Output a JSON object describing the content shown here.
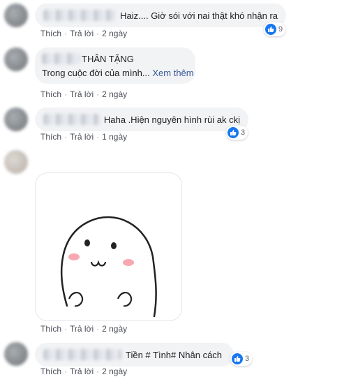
{
  "comments": [
    {
      "text": "Haiz.... Giờ sói với nai thật khó nhận ra",
      "reactions": "9",
      "actions": {
        "like": "Thích",
        "reply": "Trả lời",
        "time": "2 ngày"
      }
    },
    {
      "name_suffix": "THÂN TẶNG",
      "text": "Trong cuộc đời của mình...",
      "see_more": "Xem thêm",
      "actions": {
        "like": "Thích",
        "reply": "Trả lời",
        "time": "2 ngày"
      }
    },
    {
      "text": "Haha .Hiện nguyên hình rùi ak ckị",
      "reactions": "3",
      "actions": {
        "like": "Thích",
        "reply": "Trả lời",
        "time": "1 ngày"
      }
    },
    {
      "sticker": "cute-blob-sticker",
      "actions": {
        "like": "Thích",
        "reply": "Trả lời",
        "time": "2 ngày"
      }
    },
    {
      "text": "Tiền # Tình# Nhân cách",
      "reactions": "3",
      "actions": {
        "like": "Thích",
        "reply": "Trả lời",
        "time": "2 ngày"
      }
    }
  ],
  "colors": {
    "like_blue": "#1877f2",
    "bubble_bg": "#f2f3f5",
    "meta_text": "#606770"
  }
}
